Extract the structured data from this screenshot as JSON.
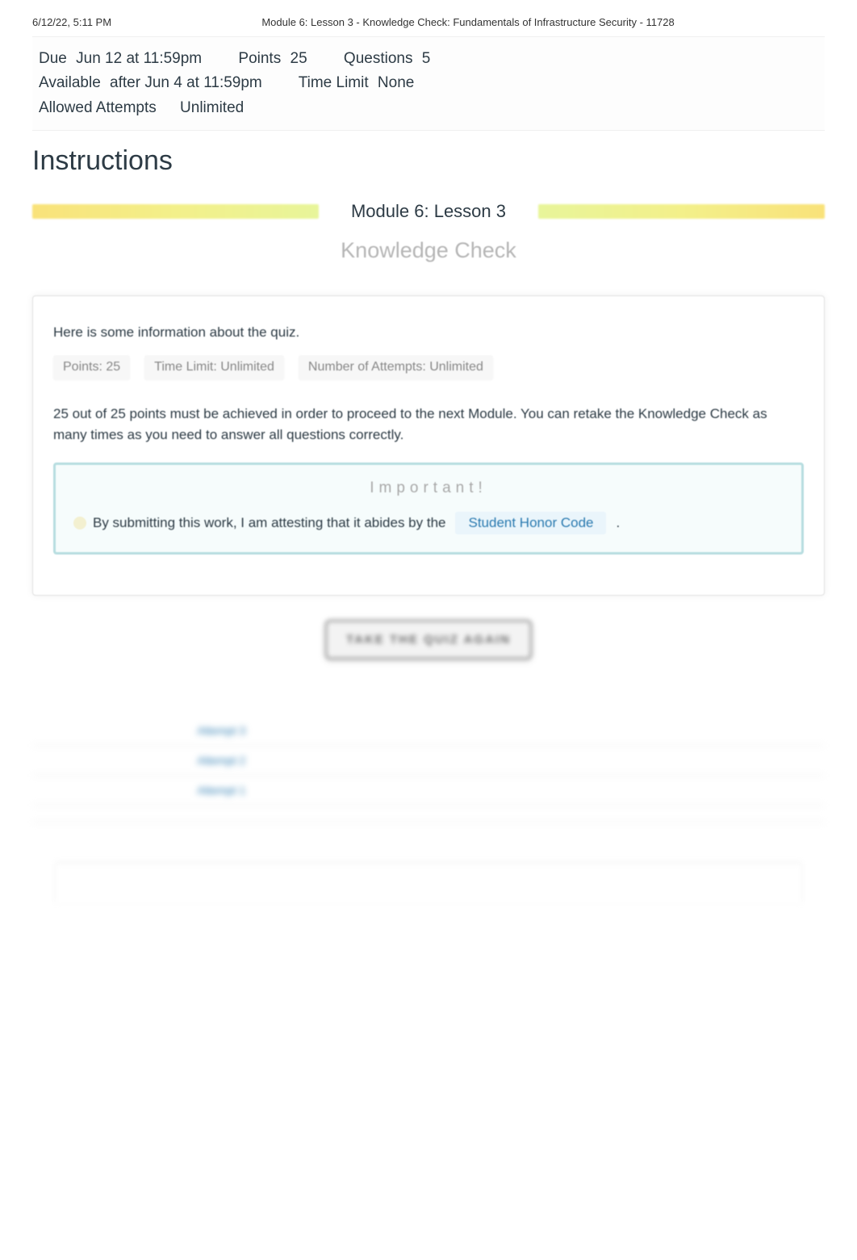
{
  "print_header": {
    "datetime": "6/12/22, 5:11 PM",
    "title": "Module 6: Lesson 3 - Knowledge Check: Fundamentals of Infrastructure Security - 11728"
  },
  "meta": {
    "due_label": "Due",
    "due_value": "Jun 12 at 11:59pm",
    "points_label": "Points",
    "points_value": "25",
    "questions_label": "Questions",
    "questions_value": "5",
    "available_label": "Available",
    "available_value": "after Jun 4 at 11:59pm",
    "timelimit_label": "Time Limit",
    "timelimit_value": "None",
    "attempts_label": "Allowed Attempts",
    "attempts_value": "Unlimited"
  },
  "instructions_heading": "Instructions",
  "module_title": "Module 6: Lesson 3",
  "knowledge_check": "Knowledge Check",
  "quiz_card": {
    "intro": "Here is some information about the quiz.",
    "badge_points": "Points: 25",
    "badge_timelimit": "Time Limit: Unlimited",
    "badge_attempts": "Number of Attempts: Unlimited",
    "pass_text": "25 out of 25 points must be achieved in order to proceed to the next Module. You can retake the Knowledge Check as many times as you need to answer all questions correctly."
  },
  "important": {
    "title": "Important!",
    "prefix": "By submitting this work, I am attesting that it abides by the",
    "link_text": "Student Honor Code",
    "suffix": "."
  },
  "take_quiz_button": "TAKE THE QUIZ AGAIN",
  "attempts": {
    "rows": [
      {
        "col1": "",
        "col2": "Attempt 3",
        "col3": "",
        "col4": ""
      },
      {
        "col1": "",
        "col2": "Attempt 2",
        "col3": "",
        "col4": ""
      },
      {
        "col1": "",
        "col2": "Attempt 1",
        "col3": "",
        "col4": ""
      }
    ]
  }
}
